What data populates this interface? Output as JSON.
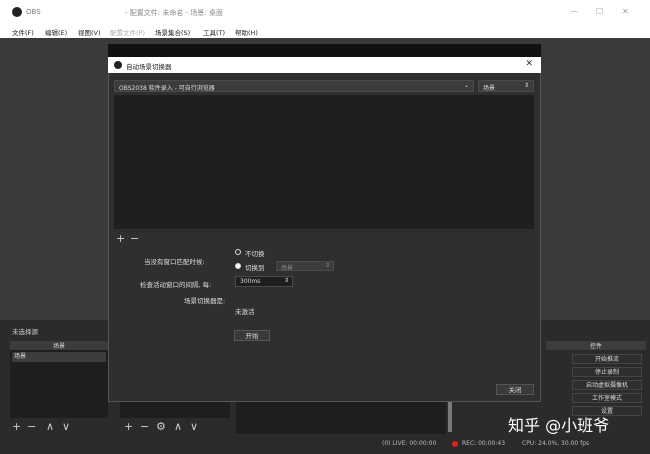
{
  "app": {
    "name": "OBS",
    "document_title": "- 配置文件: 未命名 - 场景: 桌面"
  },
  "menu": [
    {
      "label": "文件(F)"
    },
    {
      "label": "编辑(E)"
    },
    {
      "label": "视图(V)"
    },
    {
      "label": "配置文件(P)"
    },
    {
      "label": "场景集合(S)"
    },
    {
      "label": "工具(T)"
    },
    {
      "label": "帮助(H)"
    }
  ],
  "docks": {
    "not_selected": "未选择源",
    "scenes_header": "场景",
    "scenes_item": "场景",
    "controls_header": "控件"
  },
  "controls": [
    "开始推流",
    "停止录制",
    "启动虚拟摄像机",
    "工作室模式",
    "设置"
  ],
  "dialog": {
    "title": "自动场景切换器",
    "window_combo": "OBS2038 软件录入 - 可自行浏览器",
    "scene_combo": "场景",
    "add": "+",
    "remove": "−",
    "no_window_label": "当没有窗口匹配时候:",
    "radio_dont_switch": "不切换",
    "radio_switch_to": "切换到",
    "switch_scene": "场景",
    "interval_label": "检查活动窗口的间隔, 每:",
    "interval_value": "300ms",
    "status_label": "场景切换器是:",
    "status_value": "未激活",
    "start_button": "开始",
    "close_button": "关闭"
  },
  "status": {
    "live": "(0) LIVE: 00:00:00",
    "rec": "REC: 00:00:43",
    "cpu": "CPU: 24.0%, 30.00 fps"
  },
  "watermark": "知乎 @小班爷"
}
